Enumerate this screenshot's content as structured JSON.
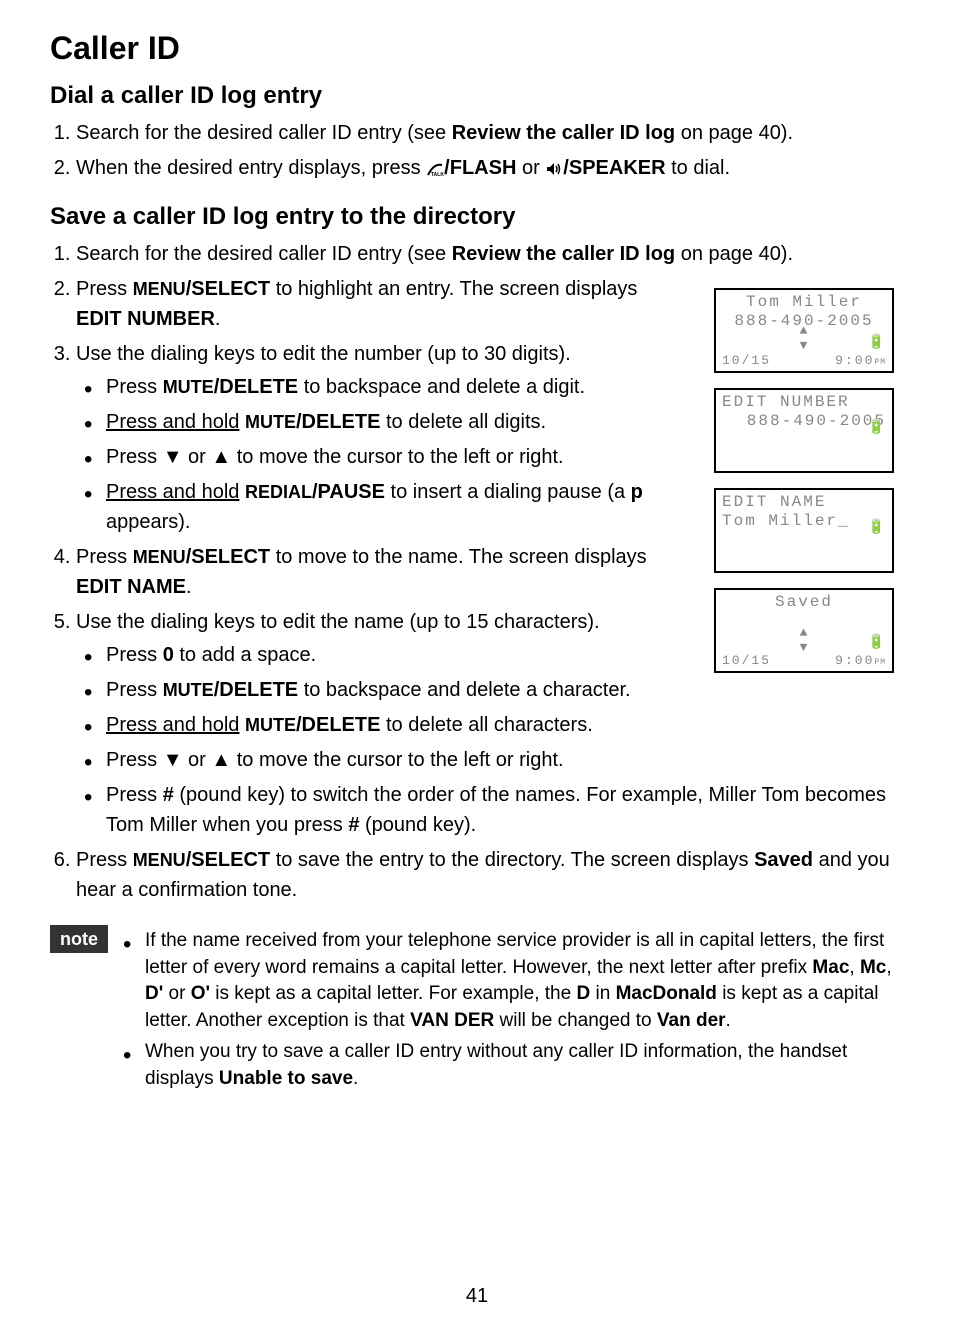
{
  "title": "Caller ID",
  "section1": {
    "heading": "Dial a caller ID log entry",
    "step1_prefix": "Search for the desired caller ID entry (see ",
    "step1_bold": "Review the caller ID log",
    "step1_suffix": " on page 40).",
    "step2_prefix": "When the desired entry displays, press ",
    "step2_flash": "/FLASH",
    "step2_or": " or ",
    "step2_speaker": "/SPEAKER",
    "step2_suffix": " to dial."
  },
  "section2": {
    "heading": "Save a caller ID log entry to the directory",
    "step1_prefix": "Search for the desired caller ID entry (see ",
    "step1_bold": "Review the caller ID log",
    "step1_suffix": " on page 40).",
    "step2_prefix": "Press ",
    "step2_menu": "MENU",
    "step2_select": "/SELECT",
    "step2_mid": " to highlight an entry. The screen displays ",
    "step2_bold": "EDIT NUMBER",
    "step2_suffix": ".",
    "step3": "Use the dialing keys to edit the number (up to 30 digits).",
    "step3_bullet1_prefix": "Press ",
    "step3_bullet1_mute": "MUTE",
    "step3_bullet1_delete": "/DELETE",
    "step3_bullet1_suffix": " to backspace and delete a digit.",
    "step3_bullet2_prefix": "Press and hold",
    "step3_bullet2_space": " ",
    "step3_bullet2_mute": "MUTE",
    "step3_bullet2_delete": "/DELETE",
    "step3_bullet2_suffix": " to delete all digits.",
    "step3_bullet3_prefix": "Press ",
    "step3_bullet3_or": " or ",
    "step3_bullet3_suffix": " to move the cursor to the left or right.",
    "step3_bullet4_prefix": "Press and hold",
    "step3_bullet4_space": " ",
    "step3_bullet4_redial": "REDIAL",
    "step3_bullet4_pause": "/PAUSE",
    "step3_bullet4_mid": " to insert a dialing pause (a ",
    "step3_bullet4_p": "p",
    "step3_bullet4_suffix": " appears).",
    "step4_prefix": "Press ",
    "step4_menu": "MENU",
    "step4_select": "/SELECT",
    "step4_mid": " to move to the name. The screen displays ",
    "step4_bold": "EDIT NAME",
    "step4_suffix": ".",
    "step5": "Use the dialing keys to edit the name (up to 15 characters).",
    "step5_bullet1_prefix": "Press ",
    "step5_bullet1_zero": "0",
    "step5_bullet1_suffix": " to add a space.",
    "step5_bullet2_prefix": "Press ",
    "step5_bullet2_mute": "MUTE",
    "step5_bullet2_delete": "/DELETE",
    "step5_bullet2_suffix": " to backspace and delete a character.",
    "step5_bullet3_prefix": "Press and hold",
    "step5_bullet3_space": " ",
    "step5_bullet3_mute": "MUTE",
    "step5_bullet3_delete": "/DELETE",
    "step5_bullet3_suffix": " to delete all characters.",
    "step5_bullet4_prefix": "Press ",
    "step5_bullet4_or": " or ",
    "step5_bullet4_suffix": " to move the cursor to the left or right.",
    "step5_bullet5_prefix": "Press ",
    "step5_bullet5_pound": "#",
    "step5_bullet5_mid": " (pound key) to switch the order of the names. For example, Miller Tom becomes Tom Miller when you press ",
    "step5_bullet5_pound2": "#",
    "step5_bullet5_suffix": " (pound key).",
    "step6_prefix": "Press ",
    "step6_menu": "MENU",
    "step6_select": "/SELECT",
    "step6_mid": " to save the entry to the directory. The screen displays ",
    "step6_bold": "Saved",
    "step6_suffix": " and you hear a confirmation tone."
  },
  "note": {
    "label": "note",
    "bullet1_prefix": "If the name received from your telephone service provider is all in capital letters, the first letter of every word remains a capital letter. However, the next letter after prefix ",
    "bullet1_mac": "Mac",
    "bullet1_c1": ", ",
    "bullet1_mc": "Mc",
    "bullet1_c2": ", ",
    "bullet1_d": "D'",
    "bullet1_or": " or ",
    "bullet1_o": "O'",
    "bullet1_mid": " is kept as a capital letter. For example, the ",
    "bullet1_dletter": "D",
    "bullet1_in": " in ",
    "bullet1_macdonald": "MacDonald",
    "bullet1_mid2": " is kept as a capital letter. Another exception is that ",
    "bullet1_vander": "VAN DER",
    "bullet1_mid3": " will be changed to ",
    "bullet1_vander2": "Van der",
    "bullet1_suffix": ".",
    "bullet2_prefix": "When you try to save a caller ID entry without any caller ID information, the handset displays ",
    "bullet2_bold": "Unable to save",
    "bullet2_suffix": "."
  },
  "lcd": {
    "screen1": {
      "line1": "Tom Miller",
      "line2": "888-490-2005",
      "date": "10/15",
      "time": "9:00",
      "ampm": "PM"
    },
    "screen2": {
      "line1": "EDIT NUMBER",
      "line2": "888-490-2005"
    },
    "screen3": {
      "line1": "EDIT NAME",
      "line2": "Tom Miller_"
    },
    "screen4": {
      "line1": "Saved",
      "date": "10/15",
      "time": "9:00",
      "ampm": "PM"
    }
  },
  "page_number": "41"
}
